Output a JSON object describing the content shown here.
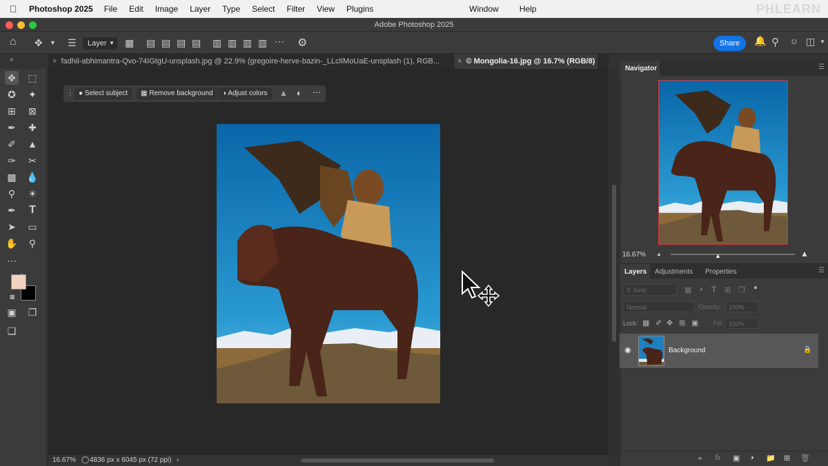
{
  "menubar": {
    "app_name": "Photoshop 2025",
    "menus": [
      "File",
      "Edit",
      "Image",
      "Layer",
      "Type",
      "Select",
      "Filter",
      "View",
      "Plugins"
    ],
    "right_menus": [
      "Window",
      "Help"
    ],
    "watermark": "PHLEARN"
  },
  "window": {
    "title": "Adobe Photoshop 2025"
  },
  "options": {
    "layer_select": "Layer",
    "share_label": "Share"
  },
  "tabs": [
    {
      "label": "fadhil-abhimantra-Qvo-74IGtgU-unsplash.jpg @ 22.9% (gregoire-herve-bazin-_LLclIMoUaE-unsplash (1), RGB...",
      "active": false
    },
    {
      "label": "© Mongolia-16.jpg @ 16.7% (RGB/8)",
      "active": true
    }
  ],
  "contextual_bar": {
    "select_subject": "Select subject",
    "remove_background": "Remove background",
    "adjust_colors": "Adjust colors"
  },
  "colors": {
    "foreground": "#f3d3bf",
    "background": "#000000",
    "accent": "#1473e6"
  },
  "status": {
    "zoom": "16.67%",
    "doc_info": "4836 px x 6045 px (72 ppi)"
  },
  "navigator": {
    "title": "Navigator",
    "zoom": "16.67%"
  },
  "layers_panel": {
    "tabs": [
      "Layers",
      "Adjustments",
      "Properties"
    ],
    "kind_placeholder": "Kind",
    "blend_mode": "Normal",
    "opacity_label": "Opacity:",
    "opacity_value": "100%",
    "lock_label": "Lock:",
    "fill_label": "Fill:",
    "fill_value": "100%",
    "layers": [
      {
        "name": "Background",
        "visible": true,
        "locked": true
      }
    ]
  }
}
